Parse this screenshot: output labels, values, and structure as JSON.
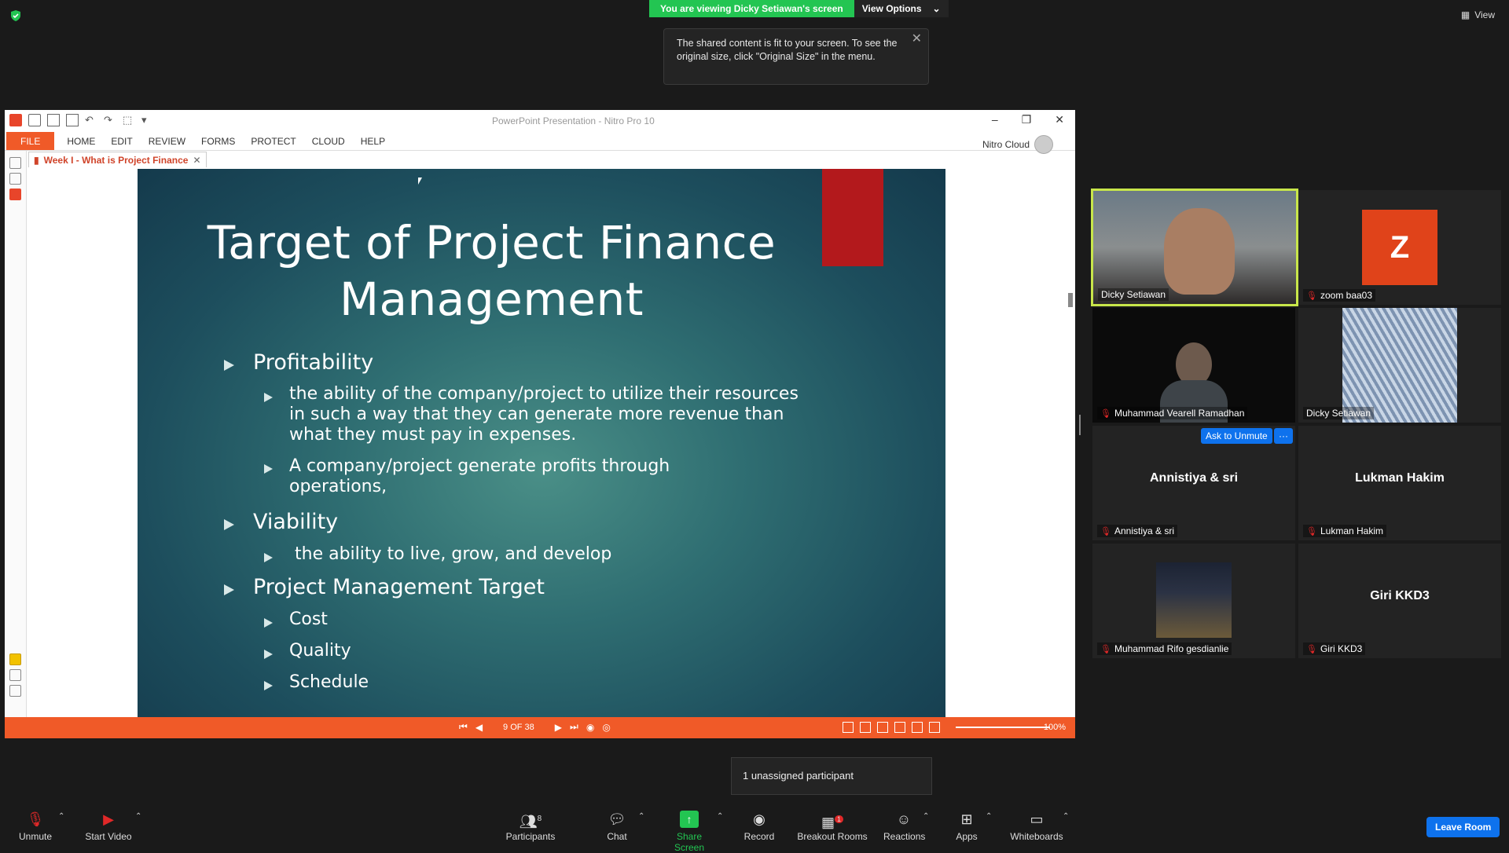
{
  "zoom": {
    "banner_text": "You are viewing Dicky Setiawan's screen",
    "view_options": "View Options",
    "tooltip": "The shared content is fit to your screen. To see the original size, click \"Original Size\" in the menu.",
    "view_label": "View"
  },
  "nitro": {
    "window_title": "PowerPoint Presentation - Nitro Pro 10",
    "menu": [
      "FILE",
      "HOME",
      "EDIT",
      "REVIEW",
      "FORMS",
      "PROTECT",
      "CLOUD",
      "HELP"
    ],
    "account": "Nitro Cloud",
    "doc_tab": "Week I - What is Project Finance",
    "page_indicator": "9 OF 38",
    "zoom_level": "100%"
  },
  "slide": {
    "title_line1": "Target of Project Finance",
    "title_line2": "Management",
    "b1": "Profitability",
    "b1a": "the ability of the company/project  to utilize their resources in such a way that they can generate more revenue than what they must pay in expenses.",
    "b1b": "A company/project generate profits through operations,",
    "b2": "Viability",
    "b2a": "the ability to live, grow, and develop",
    "b3": "Project Management Target",
    "b3a": "Cost",
    "b3b": "Quality",
    "b3c": "Schedule"
  },
  "participants": {
    "t1": "Dicky Setiawan",
    "t2": "zoom baa03",
    "t2_avatar": "Z",
    "t3": "Muhammad Vearell Ramadhan",
    "t4": "Dicky Setiawan",
    "t5": "Annistiya & sri",
    "t6": "Lukman Hakim",
    "t7": "Muhammad Rifo gesdianlie",
    "t8": "Giri KKD3",
    "ask_unmute": "Ask to Unmute",
    "more": "···"
  },
  "unassigned": "1 unassigned participant",
  "toolbar": {
    "unmute": "Unmute",
    "start_video": "Start Video",
    "participants": "Participants",
    "participants_count": "8",
    "chat": "Chat",
    "share_screen": "Share Screen",
    "record": "Record",
    "breakout": "Breakout Rooms",
    "breakout_badge": "1",
    "reactions": "Reactions",
    "apps": "Apps",
    "whiteboards": "Whiteboards",
    "leave": "Leave Room"
  }
}
